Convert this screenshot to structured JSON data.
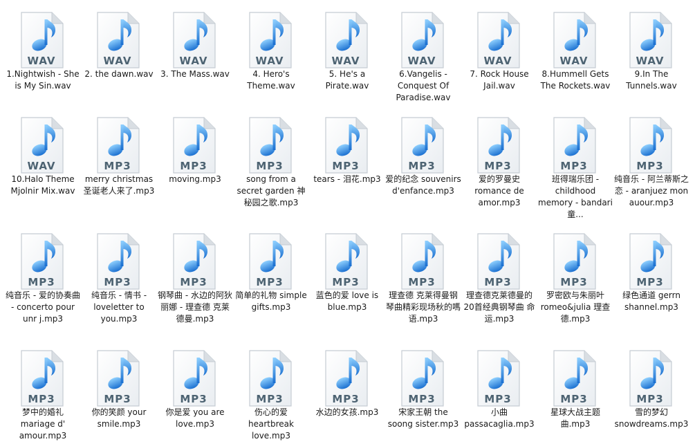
{
  "icons": {
    "file_icon": "audio-file-icon",
    "music_note": "music-note-icon"
  },
  "colors": {
    "note_light": "#8fd0ff",
    "note_dark": "#1a6fd0",
    "label_text": "#4d6372",
    "page_fold": "#d9dee3"
  },
  "files": [
    {
      "format": "WAV",
      "name": "1.Nightwish - She is My Sin.wav"
    },
    {
      "format": "WAV",
      "name": "2. the dawn.wav"
    },
    {
      "format": "WAV",
      "name": "3. The Mass.wav"
    },
    {
      "format": "WAV",
      "name": "4. Hero's Theme.wav"
    },
    {
      "format": "WAV",
      "name": "5. He's a Pirate.wav"
    },
    {
      "format": "WAV",
      "name": "6.Vangelis - Conquest Of Paradise.wav"
    },
    {
      "format": "WAV",
      "name": "7. Rock House Jail.wav"
    },
    {
      "format": "WAV",
      "name": "8.Hummell Gets The Rockets.wav"
    },
    {
      "format": "WAV",
      "name": "9.In The Tunnels.wav"
    },
    {
      "format": "WAV",
      "name": "10.Halo Theme Mjolnir Mix.wav"
    },
    {
      "format": "MP3",
      "name": "merry christmas 圣诞老人来了.mp3"
    },
    {
      "format": "MP3",
      "name": "moving.mp3"
    },
    {
      "format": "MP3",
      "name": "song from a secret garden 神秘园之歌.mp3"
    },
    {
      "format": "MP3",
      "name": "tears - 泪花.mp3"
    },
    {
      "format": "MP3",
      "name": "爱的纪念 souvenirs d'enfance.mp3"
    },
    {
      "format": "MP3",
      "name": "爱的罗曼史 romance de amor.mp3"
    },
    {
      "format": "MP3",
      "name": "班得瑞乐团 - childhood memory - bandari 童..."
    },
    {
      "format": "MP3",
      "name": "纯音乐 - 阿兰蒂斯之恋 - aranjuez mon auour.mp3"
    },
    {
      "format": "MP3",
      "name": "纯音乐 - 爱的协奏曲 - concerto pour unr j.mp3"
    },
    {
      "format": "MP3",
      "name": "纯音乐 - 情书 - loveletter to you.mp3"
    },
    {
      "format": "MP3",
      "name": "钢琴曲 - 水边的阿狄丽娜 - 理查德 克莱德曼.mp3"
    },
    {
      "format": "MP3",
      "name": "简单的礼物 simple gifts.mp3"
    },
    {
      "format": "MP3",
      "name": "蓝色的爱 love is blue.mp3"
    },
    {
      "format": "MP3",
      "name": "理查德 克莱得曼钢琴曲精彩现场秋的嗎语.mp3"
    },
    {
      "format": "MP3",
      "name": "理查德克莱德曼的 20首经典钢琴曲 命运.mp3"
    },
    {
      "format": "MP3",
      "name": "罗密欧与朱丽叶 romeo&julia 理查德.mp3"
    },
    {
      "format": "MP3",
      "name": "绿色通道 gerrn shannel.mp3"
    },
    {
      "format": "MP3",
      "name": "梦中的婚礼 mariage d' amour.mp3"
    },
    {
      "format": "MP3",
      "name": "你的笑颜 your smile.mp3"
    },
    {
      "format": "MP3",
      "name": "你是爱 you are love.mp3"
    },
    {
      "format": "MP3",
      "name": "伤心的爱 heartbreak love.mp3"
    },
    {
      "format": "MP3",
      "name": "水边的女孩.mp3"
    },
    {
      "format": "MP3",
      "name": "宋家王朝 the soong sister.mp3"
    },
    {
      "format": "MP3",
      "name": "小曲 passacaglia.mp3"
    },
    {
      "format": "MP3",
      "name": "星球大战主题曲.mp3"
    },
    {
      "format": "MP3",
      "name": "雪的梦幻 snowdreams.mp3"
    }
  ]
}
